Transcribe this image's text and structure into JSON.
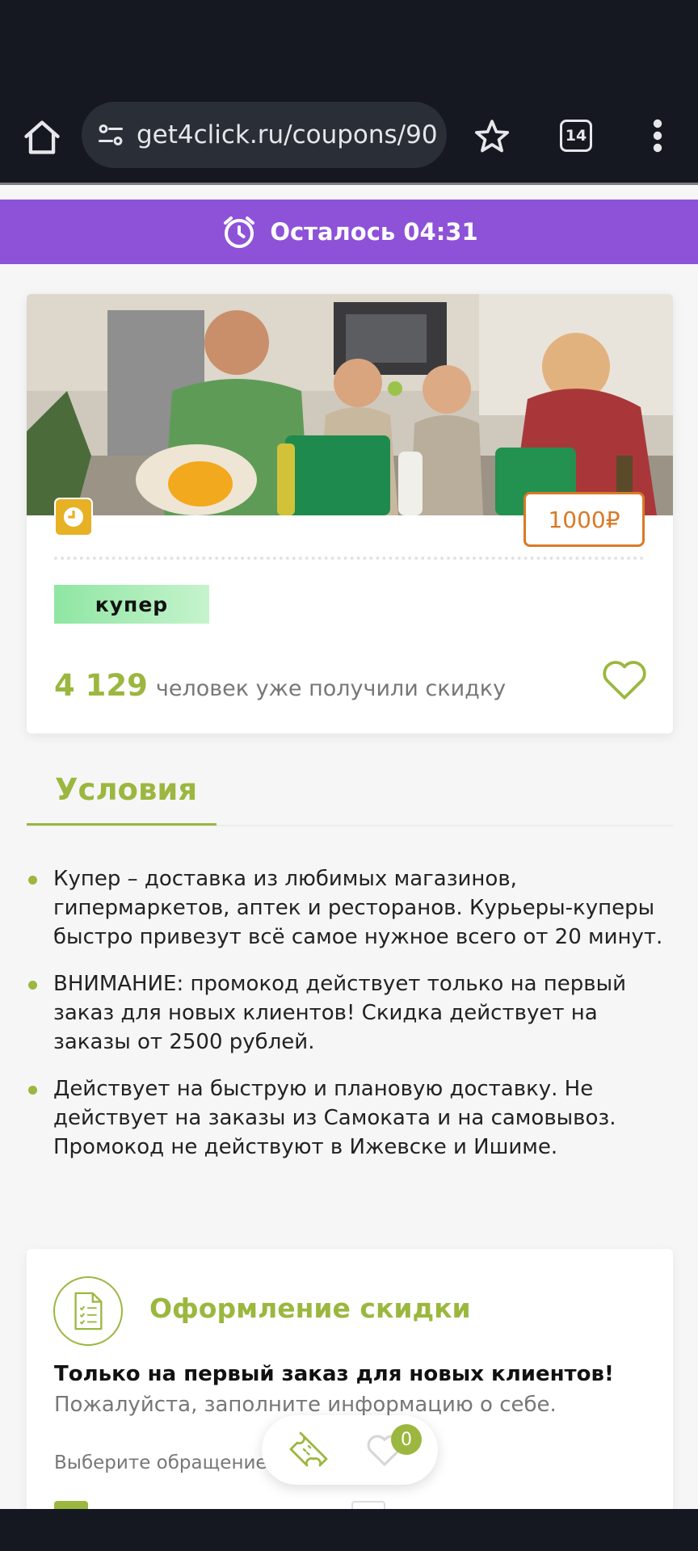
{
  "browser": {
    "url": "get4click.ru/coupons/90",
    "tab_count": "14"
  },
  "timer": {
    "text": "Осталось 04:31"
  },
  "coupon": {
    "price": "1000₽",
    "brand_logo_text": "купер",
    "recipients_count": "4 129",
    "recipients_text": "человек уже получили скидку"
  },
  "conditions": {
    "title": "Условия",
    "items": [
      "Купер – доставка из любимых магазинов, гипермаркетов, аптек и ресторанов. Курьеры-куперы быстро привезут всё самое нужное всего от 20 минут.",
      "ВНИМАНИЕ: промокод действует только на первый заказ для новых клиентов! Скидка действует на заказы от 2500 рублей.",
      "Действует на быструю и плановую доставку. Не действует на заказы из Самоката и на самовывоз. Промокод не действуют в Ижевске и Ишиме."
    ]
  },
  "form": {
    "title": "Оформление скидки",
    "bold_note": "Только на первый заказ для новых клиентов!",
    "subtitle": "Пожалуйста, заполните информацию о себе.",
    "salutation_label": "Выберите обращение"
  },
  "floating": {
    "favorites_count": "0"
  },
  "colors": {
    "accent_green": "#9bb73f",
    "timer_purple": "#8d52d8",
    "price_orange": "#d97a26",
    "badge_yellow": "#e7b126"
  }
}
